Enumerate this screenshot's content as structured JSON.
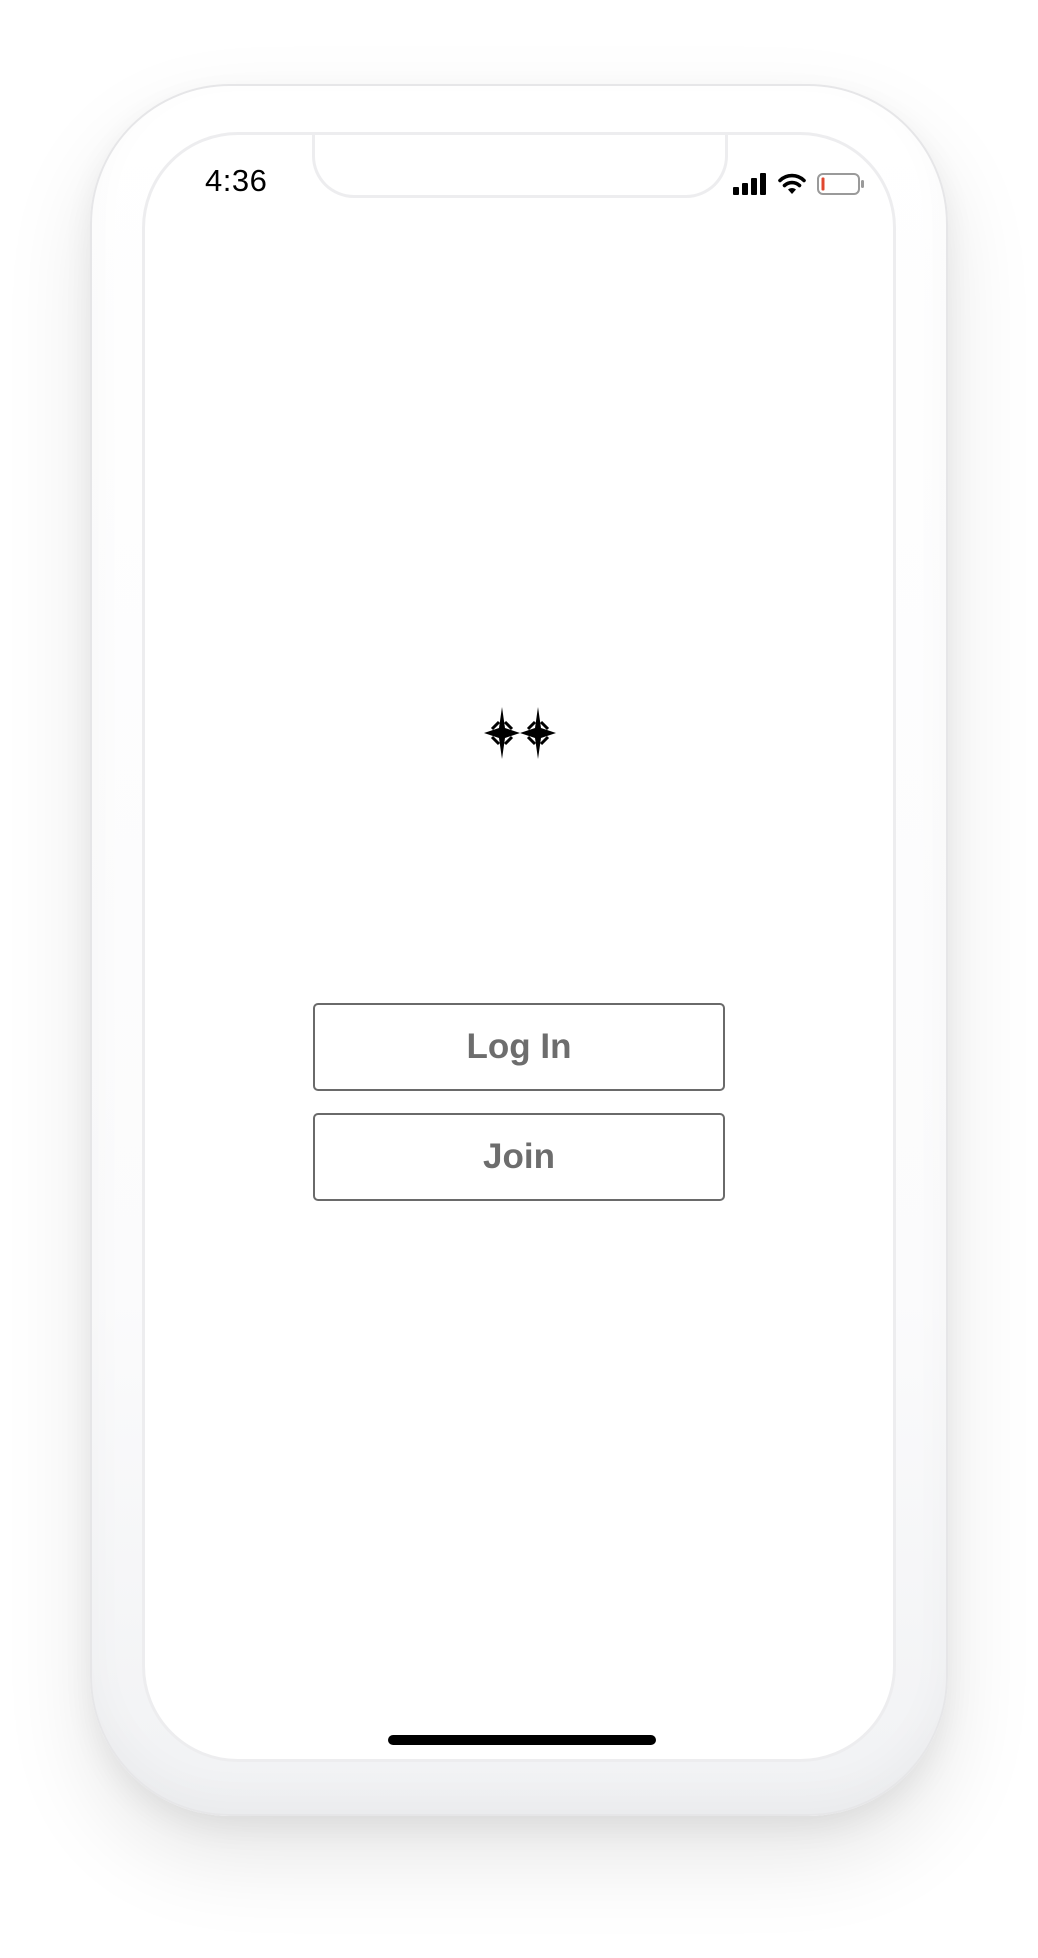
{
  "status_bar": {
    "time": "4:36",
    "icons": [
      "cellular-signal-icon",
      "wifi-icon",
      "battery-icon"
    ],
    "battery_level_fraction": 0.08
  },
  "logo": {
    "icon": "two-stars-logo-icon"
  },
  "auth": {
    "login_label": "Log In",
    "join_label": "Join"
  },
  "colors": {
    "button_border": "#6a6a6a",
    "button_text": "#6d6d6d",
    "battery_low": "#e0472f",
    "screen_bg": "#ffffff"
  }
}
